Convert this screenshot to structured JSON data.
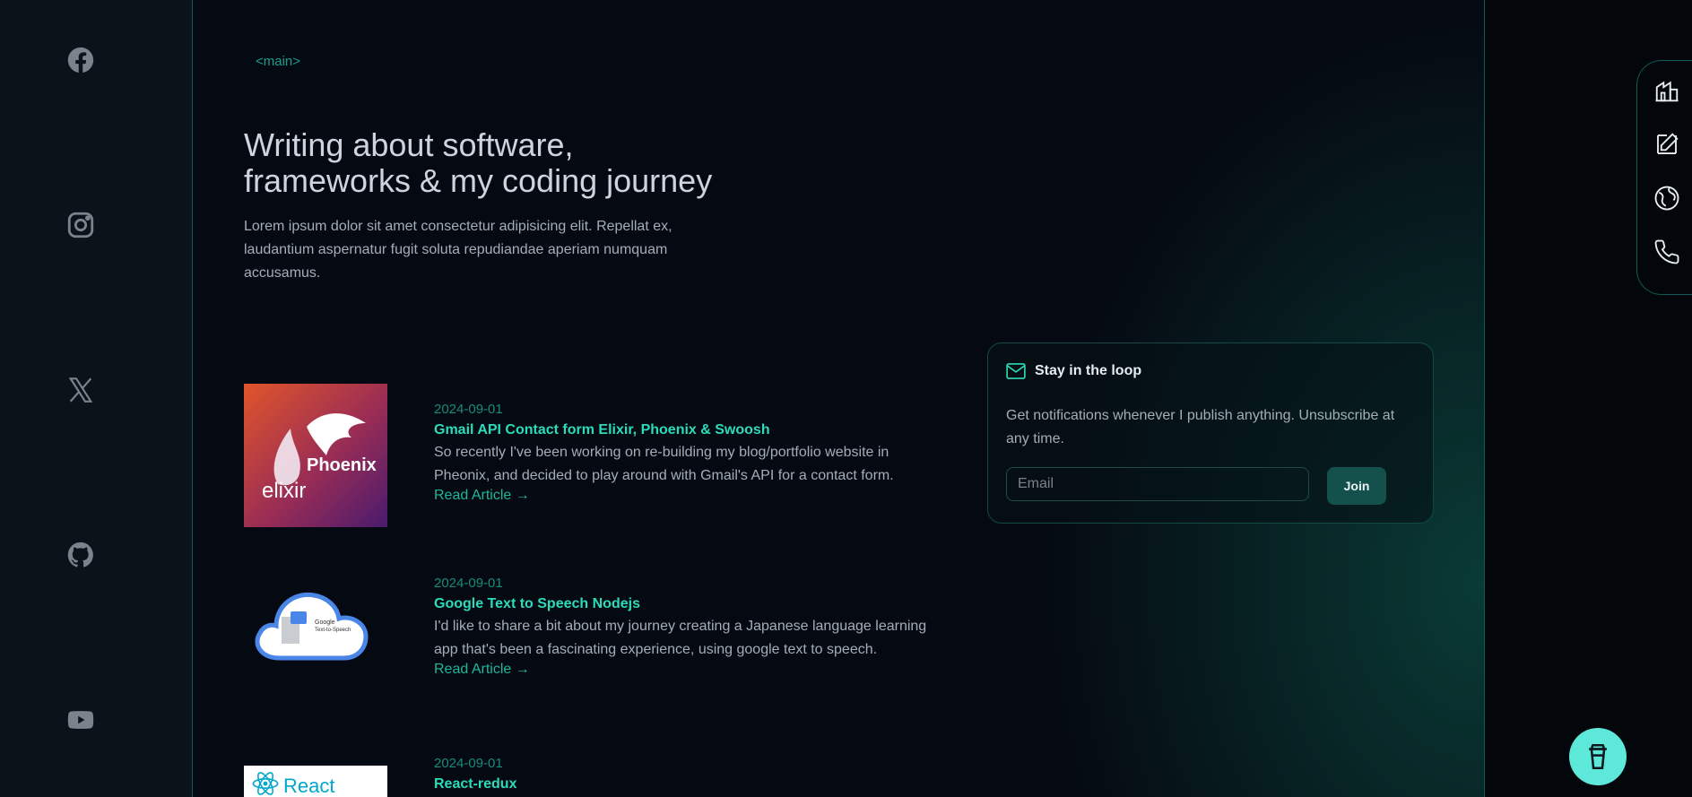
{
  "social": [
    {
      "name": "facebook",
      "icon": "facebook-icon"
    },
    {
      "name": "instagram",
      "icon": "instagram-icon"
    },
    {
      "name": "x",
      "icon": "x-icon"
    },
    {
      "name": "github",
      "icon": "github-icon"
    },
    {
      "name": "youtube",
      "icon": "youtube-icon"
    }
  ],
  "main": {
    "tag": "<main>",
    "title_line1": "Writing about software,",
    "title_line2": "frameworks & my coding journey",
    "description": "Lorem ipsum dolor sit amet consectetur adipisicing elit. Repellat ex, laudantium aspernatur fugit soluta repudiandae aperiam numquam accusamus."
  },
  "articles": [
    {
      "date": "2024-09-01",
      "title": "Gmail API Contact form Elixir, Phoenix & Swoosh",
      "description": "So recently I've been working on re-building my blog/portfolio website in Pheonix, and decided to play around with Gmail's API for a contact form.",
      "link": "Read Article →",
      "thumb_text_1": "Phoenix",
      "thumb_text_2": "elixir"
    },
    {
      "date": "2024-09-01",
      "title": "Google Text to Speech Nodejs",
      "description": "I'd like to share a bit about my journey creating a Japanese language learning app that's been a fascinating experience, using google text to speech.",
      "link": "Read Article →",
      "thumb_text_1": "Google",
      "thumb_text_2": "Text-to-Speech"
    },
    {
      "date": "2024-09-01",
      "title": "React-redux",
      "thumb_text_1": "React"
    }
  ],
  "newsletter": {
    "title": "Stay in the loop",
    "text": "Get notifications whenever I publish anything. Unsubscribe at any time.",
    "placeholder": "Email",
    "button": "Join"
  },
  "side_nav": [
    {
      "icon": "home-icon"
    },
    {
      "icon": "edit-icon"
    },
    {
      "icon": "globe-icon"
    },
    {
      "icon": "phone-icon"
    }
  ],
  "coffee": {
    "icon": "coffee-cup-icon"
  },
  "colors": {
    "accent": "#2cdbb9",
    "background": "#050a12",
    "border": "#0f5a55"
  }
}
